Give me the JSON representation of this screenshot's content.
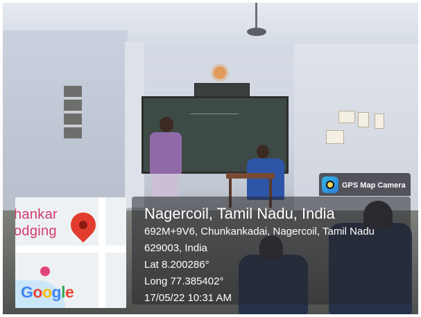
{
  "map": {
    "text_line1": "hankar",
    "text_line2": "odging",
    "google_text": "Google"
  },
  "gps_badge": {
    "label": "GPS Map Camera"
  },
  "location": {
    "title": "Nagercoil, Tamil Nadu, India",
    "address_line1": "692M+9V6, Chunkankadai, Nagercoil, Tamil Nadu",
    "address_line2": "629003, India",
    "lat": "Lat 8.200286°",
    "long": "Long 77.385402°",
    "timestamp": "17/05/22 10:31 AM"
  },
  "colors": {
    "overlay": "#28282d",
    "pin": "#e23c2e",
    "map_text": "#d13a6c"
  },
  "icons": [
    "location-pin-icon",
    "hotel-icon",
    "gps-camera-app-icon"
  ]
}
